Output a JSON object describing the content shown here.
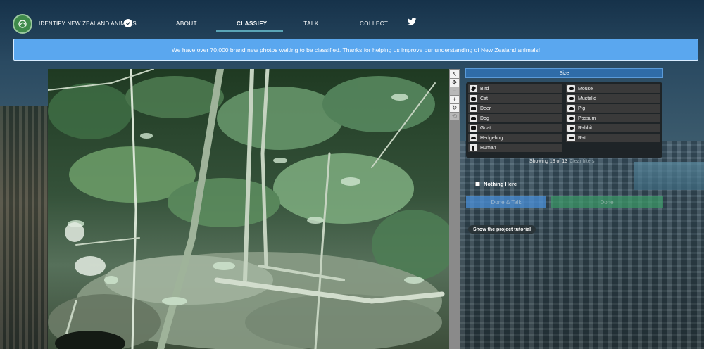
{
  "header": {
    "project_name": "IDENTIFY NEW ZEALAND ANIMALS",
    "nav": [
      {
        "label": "ABOUT"
      },
      {
        "label": "CLASSIFY",
        "active": true
      },
      {
        "label": "TALK"
      },
      {
        "label": "COLLECT"
      }
    ],
    "logo_icon": "kiwi-logo",
    "verified_icon": "check-badge-icon",
    "social_icon": "twitter-icon"
  },
  "banner": {
    "text": "We have over 70,000 brand new photos waiting to be classified. Thanks for helping us improve our understanding of New Zealand animals!"
  },
  "toolbar": {
    "tools": [
      {
        "name": "pointer-icon",
        "glyph": "↖"
      },
      {
        "name": "pan-icon",
        "glyph": "✥"
      },
      {
        "name": "zoom-out-icon",
        "glyph": "−"
      },
      {
        "name": "zoom-in-icon",
        "glyph": "+"
      },
      {
        "name": "rotate-icon",
        "glyph": "↻"
      },
      {
        "name": "reset-icon",
        "glyph": "⟲"
      }
    ]
  },
  "panel": {
    "filter_label": "Size",
    "choices_left": [
      {
        "label": "Bird",
        "icon": "bird-icon"
      },
      {
        "label": "Cat",
        "icon": "cat-icon"
      },
      {
        "label": "Deer",
        "icon": "deer-icon"
      },
      {
        "label": "Dog",
        "icon": "dog-icon"
      },
      {
        "label": "Goat",
        "icon": "goat-icon"
      },
      {
        "label": "Hedgehog",
        "icon": "hedgehog-icon"
      },
      {
        "label": "Human",
        "icon": "human-icon"
      }
    ],
    "choices_right": [
      {
        "label": "Mouse",
        "icon": "mouse-icon"
      },
      {
        "label": "Mustelid",
        "icon": "mustelid-icon"
      },
      {
        "label": "Pig",
        "icon": "pig-icon"
      },
      {
        "label": "Possum",
        "icon": "possum-icon"
      },
      {
        "label": "Rabbit",
        "icon": "rabbit-icon"
      },
      {
        "label": "Rat",
        "icon": "rat-icon"
      }
    ],
    "showing": "Showing 13 of 13",
    "clear_filters": "Clear filters",
    "nothing_here": "Nothing Here",
    "done_talk": "Done & Talk",
    "done": "Done",
    "tutorial": "Show the project tutorial"
  },
  "colors": {
    "banner": "#5aa7ef",
    "size_button": "#2f6ca8",
    "done_talk_button": "#4a90d9",
    "done_button": "#3d9c6a",
    "active_tab_underline": "#5aa5b7"
  }
}
